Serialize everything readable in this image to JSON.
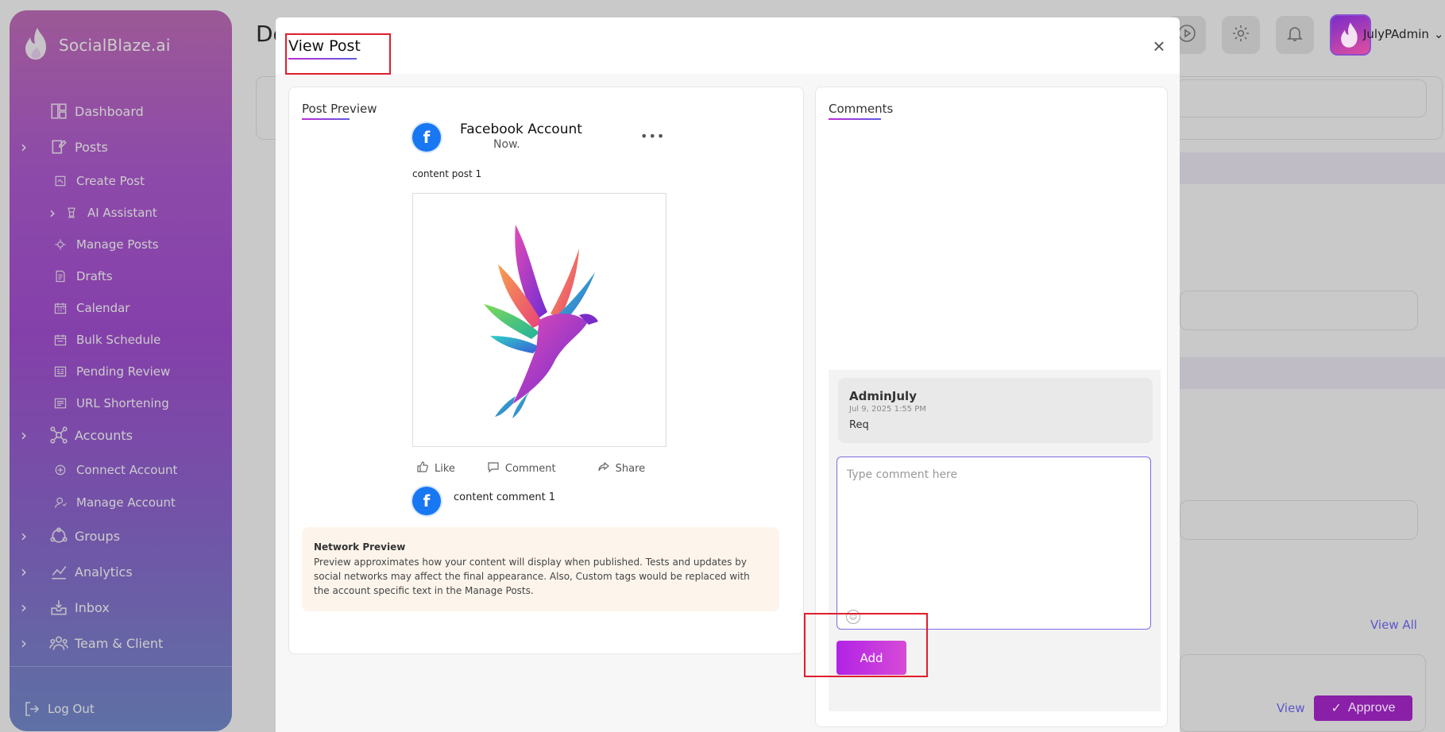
{
  "brand": {
    "name": "SocialBlaze.ai"
  },
  "sidebar": {
    "items": [
      {
        "label": "Dashboard",
        "icon": "dashboard-icon",
        "chevron": false
      },
      {
        "label": "Posts",
        "icon": "posts-icon",
        "chevron": true
      },
      {
        "label": "Create Post",
        "icon": "create-post-icon",
        "chevron": false
      },
      {
        "label": "AI Assistant",
        "icon": "ai-assistant-icon",
        "chevron": true
      },
      {
        "label": "Manage Posts",
        "icon": "manage-posts-icon",
        "chevron": false
      },
      {
        "label": "Drafts",
        "icon": "drafts-icon",
        "chevron": false
      },
      {
        "label": "Calendar",
        "icon": "calendar-icon",
        "chevron": false
      },
      {
        "label": "Bulk Schedule",
        "icon": "bulk-schedule-icon",
        "chevron": false
      },
      {
        "label": "Pending Review",
        "icon": "pending-review-icon",
        "chevron": false
      },
      {
        "label": "URL Shortening",
        "icon": "url-shortening-icon",
        "chevron": false
      },
      {
        "label": "Accounts",
        "icon": "accounts-icon",
        "chevron": true
      },
      {
        "label": "Connect Account",
        "icon": "connect-account-icon",
        "chevron": false
      },
      {
        "label": "Manage Account",
        "icon": "manage-account-icon",
        "chevron": false
      },
      {
        "label": "Groups",
        "icon": "groups-icon",
        "chevron": true
      },
      {
        "label": "Analytics",
        "icon": "analytics-icon",
        "chevron": true
      },
      {
        "label": "Inbox",
        "icon": "inbox-icon",
        "chevron": true
      },
      {
        "label": "Team & Client",
        "icon": "team-icon",
        "chevron": true
      }
    ],
    "logout": "Log Out"
  },
  "background": {
    "page_title": "De",
    "user_name": "JulyPAdmin",
    "view_all": "View All",
    "view": "View",
    "approve": "Approve"
  },
  "modal": {
    "title": "View Post",
    "preview": {
      "title": "Post Preview",
      "account_name": "Facebook Account",
      "time": "Now.",
      "content": "content post 1",
      "actions": {
        "like": "Like",
        "comment": "Comment",
        "share": "Share"
      },
      "comment": "content comment 1",
      "notice_title": "Network Preview",
      "notice_text": "Preview approximates how your content will display when published. Tests and updates by social networks may affect the final appearance. Also, Custom tags would be replaced with the account specific text in the Manage Posts."
    },
    "comments": {
      "title": "Comments",
      "items": [
        {
          "author": "AdminJuly",
          "date": "Jul 9, 2025 1:55 PM",
          "text": "Req"
        }
      ],
      "input_placeholder": "Type comment here",
      "add_label": "Add"
    }
  },
  "colors": {
    "accent": "#b222e6",
    "highlight_box": "#e11d2d",
    "facebook": "#1877f2"
  }
}
